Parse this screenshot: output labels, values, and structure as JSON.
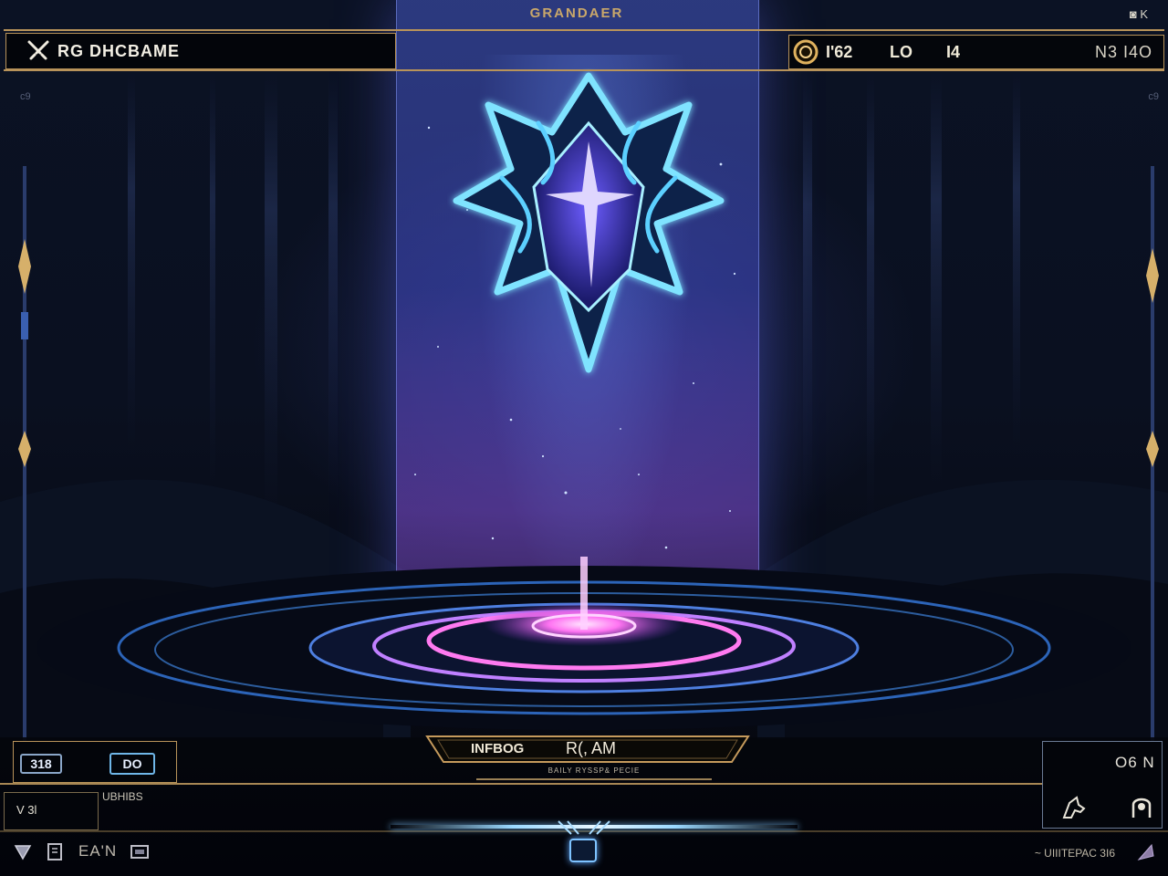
{
  "header": {
    "title": "GRANDAER",
    "left_label": "RG DHCBAME",
    "top_right_icon_text": "◙ K",
    "stats": [
      "I'62",
      "LO",
      "I4"
    ],
    "right_stat": "N3 I4O",
    "corner_left": "c9",
    "corner_right": "c9"
  },
  "bottom": {
    "box1_chip": "318",
    "box1_chip2": "DO",
    "box1_small": "UBHIBS",
    "box2_text": "V 3l",
    "plaque_left": "INFBOG",
    "plaque_right": "R(, AM",
    "plaque_sub": "BAILY RYSSP& PECIE",
    "right_label": "O6 N",
    "eain_label": "EA'N",
    "bottom_right_text": "~ UIIITEPAC 3I6"
  },
  "colors": {
    "gold": "#b8935a",
    "cyan": "#6fd7ff",
    "violet": "#b070ff",
    "magenta": "#ff6ff0"
  },
  "icons": [
    "crossed-swords-icon",
    "coin-icon",
    "triangle-icon",
    "book-icon",
    "dice-icon",
    "center-hud-icon",
    "horse-icon",
    "face-icon",
    "arrow-icon"
  ]
}
